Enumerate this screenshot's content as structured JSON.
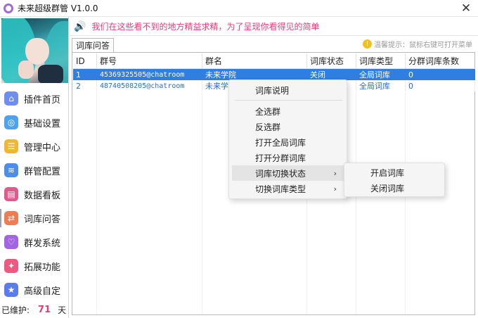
{
  "window": {
    "title": "未来超级群管 V1.0.0",
    "close_glyph": "✕"
  },
  "sidebar": {
    "items": [
      {
        "label": "插件首页",
        "icon": "house-icon",
        "glyph": "⌂",
        "color": "#6f8ef0"
      },
      {
        "label": "基础设置",
        "icon": "gear-icon",
        "glyph": "◎",
        "color": "#4ea3ef"
      },
      {
        "label": "管理中心",
        "icon": "clipboard-icon",
        "glyph": "☰",
        "color": "#f0b63a"
      },
      {
        "label": "群管配置",
        "icon": "layers-icon",
        "glyph": "≋",
        "color": "#4d8fe8"
      },
      {
        "label": "数据看板",
        "icon": "chart-icon",
        "glyph": "▤",
        "color": "#e05a8c"
      },
      {
        "label": "词库问答",
        "icon": "qa-icon",
        "glyph": "⇄",
        "color": "#f07c52"
      },
      {
        "label": "群发系统",
        "icon": "send-icon",
        "glyph": "♡",
        "color": "#a264e0"
      },
      {
        "label": "拓展功能",
        "icon": "puzzle-icon",
        "glyph": "✦",
        "color": "#ec5a82"
      },
      {
        "label": "高级自定",
        "icon": "star-icon",
        "glyph": "★",
        "color": "#5a7cf0"
      }
    ],
    "maintained_label": "已维护:",
    "maintained_days": "71",
    "days_unit": "天"
  },
  "banner": {
    "text": "我们在这些看不到的地方精益求精，为了呈现你看得见的简单",
    "icon_glyph": "🔊"
  },
  "tab": {
    "label": "词库问答"
  },
  "hint": {
    "text": "温馨提示：鼠标右键可打开菜单",
    "icon_glyph": "!"
  },
  "table": {
    "columns": [
      "ID",
      "群号",
      "群名",
      "词库状态",
      "词库类型",
      "分群词库条数"
    ],
    "rows": [
      [
        "1",
        "45369325505@chatroom",
        "未来学院",
        "关闭",
        "全局词库",
        "0"
      ],
      [
        "2",
        "48740508205@chatroom",
        "未来学",
        "",
        "全局词库",
        "0"
      ]
    ]
  },
  "context_menu": {
    "items": [
      "词库说明",
      "全选群",
      "反选群",
      "打开全局词库",
      "打开分群词库",
      "词库切换状态",
      "切换词库类型"
    ],
    "arrow_glyph": "›",
    "submenu": [
      "开启词库",
      "关闭词库"
    ]
  }
}
